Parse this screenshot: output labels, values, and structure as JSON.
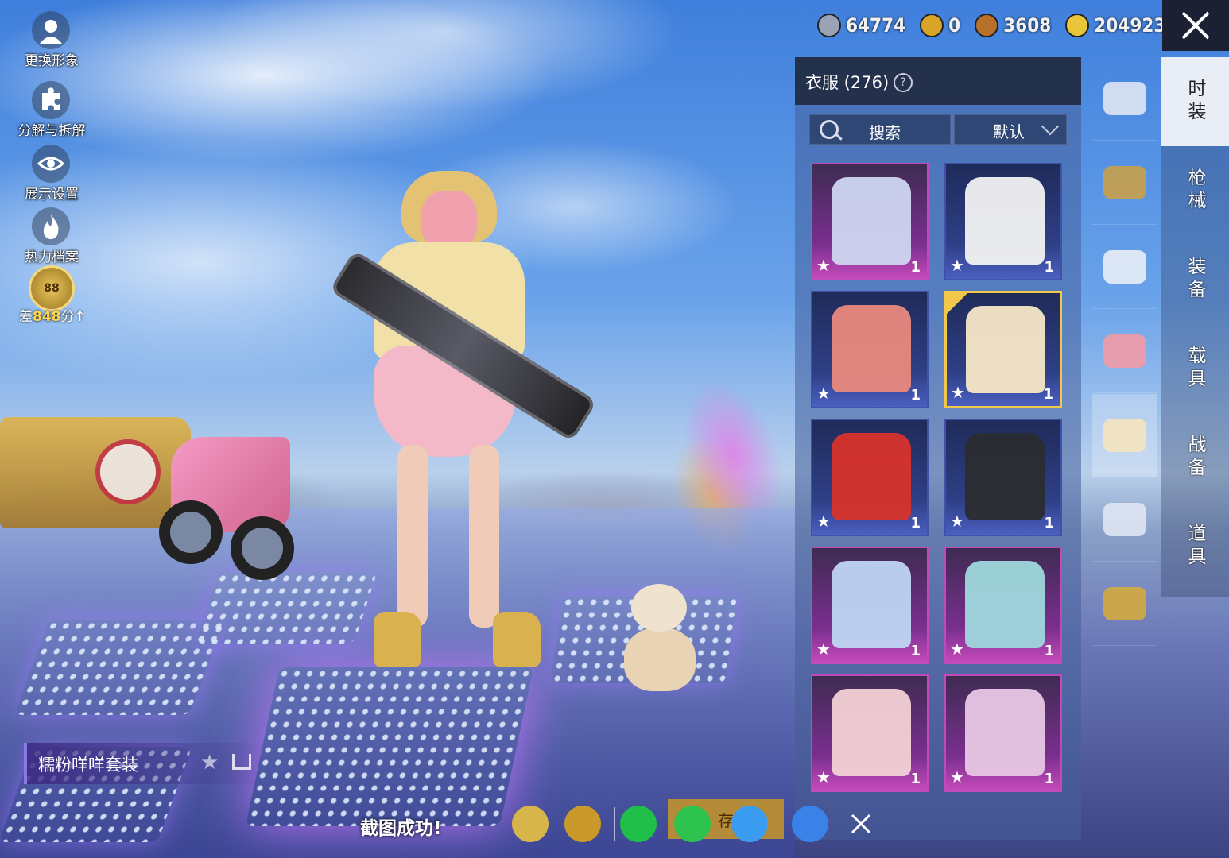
{
  "left_menu": {
    "items": [
      {
        "label": "更换形象",
        "icon": "avatar-icon"
      },
      {
        "label": "分解与拆解",
        "icon": "puzzle-icon"
      },
      {
        "label": "展示设置",
        "icon": "eye-icon"
      },
      {
        "label": "热力档案",
        "icon": "flame-icon"
      }
    ],
    "rank": {
      "badge": "88",
      "prefix": "差",
      "points": "848",
      "suffix": "分"
    }
  },
  "currencies": [
    {
      "value": "64774",
      "icon": "silver-coin-icon",
      "color": "#9aa3b5"
    },
    {
      "value": "0",
      "icon": "gold-medal-icon",
      "color": "#d9a428"
    },
    {
      "value": "3608",
      "icon": "bronze-coin-icon",
      "color": "#b9702a"
    },
    {
      "value": "204923",
      "icon": "lightning-coin-icon",
      "color": "#e9c53a"
    }
  ],
  "panel": {
    "title": "衣服 (276)",
    "search_label": "搜索",
    "sort_label": "默认"
  },
  "items": [
    {
      "count": "1",
      "rarity": "purple",
      "art": "#cfd6f0",
      "selected": false
    },
    {
      "count": "1",
      "rarity": "blue",
      "art": "#f2f2f2",
      "selected": false
    },
    {
      "count": "1",
      "rarity": "blue",
      "art": "#e9897d",
      "selected": false
    },
    {
      "count": "1",
      "rarity": "blue",
      "art": "#f5e7c6",
      "selected": true
    },
    {
      "count": "1",
      "rarity": "blue",
      "art": "#d8332b",
      "selected": false
    },
    {
      "count": "1",
      "rarity": "blue",
      "art": "#2b2c30",
      "selected": false
    },
    {
      "count": "1",
      "rarity": "purple",
      "art": "#bfd5f2",
      "selected": false
    },
    {
      "count": "1",
      "rarity": "purple",
      "art": "#9fd8dc",
      "selected": false
    },
    {
      "count": "1",
      "rarity": "purple",
      "art": "#f3d1d6",
      "selected": false
    },
    {
      "count": "1",
      "rarity": "purple",
      "art": "#e7c7e4",
      "selected": false
    }
  ],
  "categories": [
    {
      "icon": "all-category-icon",
      "color": "#dfe6f3"
    },
    {
      "icon": "hat-icon",
      "color": "#c8a04a"
    },
    {
      "icon": "glasses-icon",
      "color": "#e9eef6"
    },
    {
      "icon": "mask-icon",
      "color": "#f19aa6"
    },
    {
      "icon": "outfit-icon",
      "color": "#f5e4bf"
    },
    {
      "icon": "pants-icon",
      "color": "#dfe6f3"
    },
    {
      "icon": "shoes-icon",
      "color": "#d3a93f"
    }
  ],
  "tabs": [
    "时装",
    "枪械",
    "装备",
    "载具",
    "战备",
    "道具"
  ],
  "outfit": {
    "name": "糯粉咩咩套装"
  },
  "share": {
    "status": "截图成功!",
    "save_label": "存",
    "buttons": [
      {
        "icon": "camp-icon",
        "color": "#d8b54a"
      },
      {
        "icon": "game-logo-icon",
        "color": "#c99a2a"
      },
      {
        "icon": "wechat-icon",
        "color": "#1fbf4a"
      },
      {
        "icon": "moments-icon",
        "color": "#2ec24e"
      },
      {
        "icon": "qq-icon",
        "color": "#3a9cf0"
      },
      {
        "icon": "qzone-icon",
        "color": "#3a82e8"
      }
    ]
  }
}
